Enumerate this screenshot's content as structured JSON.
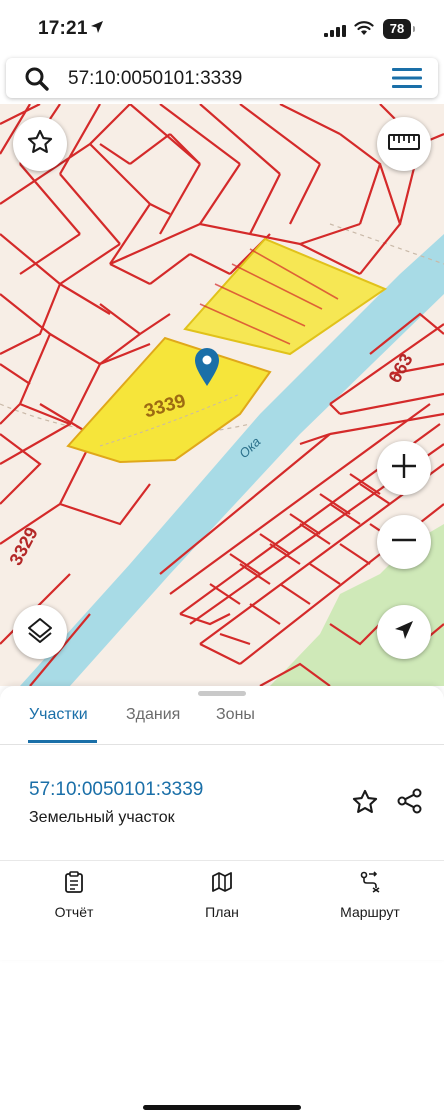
{
  "status_bar": {
    "time": "17:21",
    "battery": "78",
    "icons": [
      "location-arrow-icon",
      "cellular-signal-icon",
      "wifi-icon",
      "battery-icon"
    ]
  },
  "search": {
    "value": "57:10:0050101:3339",
    "icon": "search-icon",
    "menu_icon": "hamburger-menu-icon"
  },
  "map": {
    "labels": {
      "parcel": "3339",
      "river": "Ока",
      "parcel_left": "3329",
      "parcel_right": "663"
    },
    "colors": {
      "parcel_border": "#d42a2a",
      "highlight": "#f6e53a",
      "river": "#a8dbe6",
      "forest": "#cfe9b8",
      "pin": "#1a6fa8"
    },
    "controls": [
      "star-icon",
      "ruler-icon",
      "zoom-in-icon",
      "zoom-out-icon",
      "layers-icon",
      "locate-arrow-icon"
    ]
  },
  "sheet": {
    "tabs": [
      {
        "label": "Участки",
        "active": true
      },
      {
        "label": "Здания",
        "active": false
      },
      {
        "label": "Зоны",
        "active": false
      }
    ],
    "result": {
      "title": "57:10:0050101:3339",
      "subtitle": "Земельный участок"
    }
  },
  "bottom_nav": [
    {
      "label": "Отчёт",
      "icon": "report-clipboard-icon"
    },
    {
      "label": "План",
      "icon": "map-plan-icon"
    },
    {
      "label": "Маршрут",
      "icon": "route-icon"
    }
  ],
  "accent_color": "#1a6fa8"
}
